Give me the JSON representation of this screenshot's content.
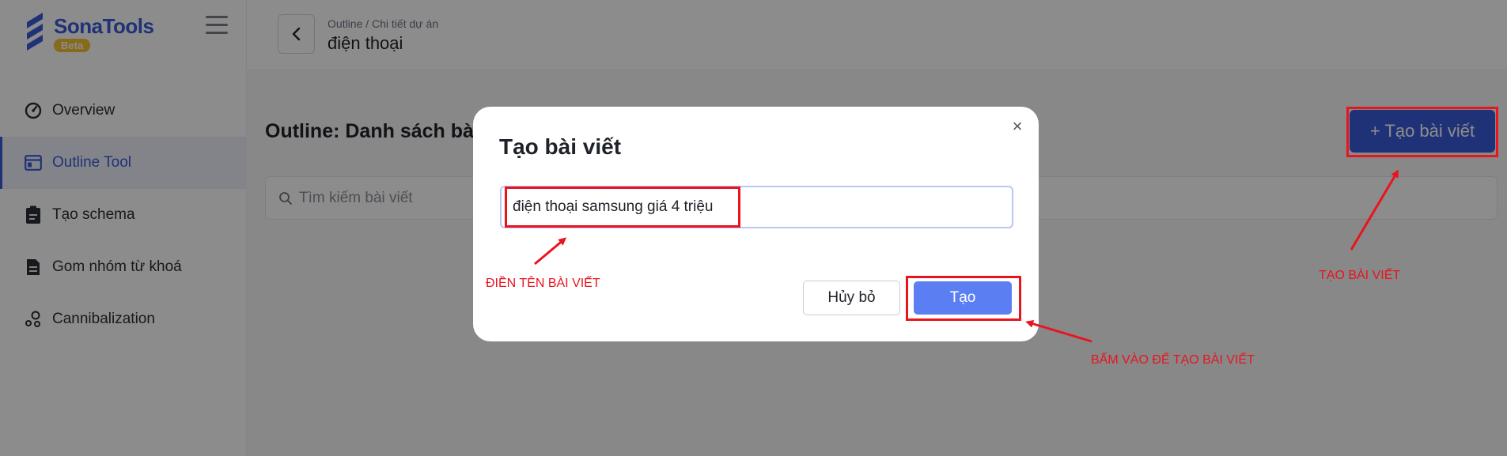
{
  "sidebar": {
    "logo_text": "SonaTools",
    "logo_badge": "Beta",
    "items": [
      {
        "label": "Overview",
        "icon": "gauge-icon"
      },
      {
        "label": "Outline Tool",
        "icon": "browser-window-icon",
        "active": true
      },
      {
        "label": "Tạo schema",
        "icon": "clipboard-icon"
      },
      {
        "label": "Gom nhóm từ khoá",
        "icon": "document-icon"
      },
      {
        "label": "Cannibalization",
        "icon": "network-nodes-icon"
      }
    ]
  },
  "header": {
    "breadcrumb": "Outline / Chi tiết dự án",
    "title": "điện thoại"
  },
  "main": {
    "outline_title": "Outline: Danh sách bà",
    "create_button": "+ Tạo bài viết",
    "search_placeholder": "Tìm kiếm bài viết"
  },
  "modal": {
    "title": "Tạo bài viết",
    "input_value": "điện thoại samsung giá 4 triệu",
    "cancel_label": "Hủy bỏ",
    "submit_label": "Tạo",
    "close_glyph": "×"
  },
  "annotations": {
    "fill_name": "ĐIỀN TÊN BÀI VIẾT",
    "create_post": "TẠO BÀI VIẾT",
    "click_to_create": "BẤM VÀO ĐỂ TẠO BÀI VIẾT",
    "color": "#e8141e"
  },
  "colors": {
    "brand": "#3b5bd9",
    "submit": "#5b7ff2",
    "badge": "#f4c430"
  }
}
